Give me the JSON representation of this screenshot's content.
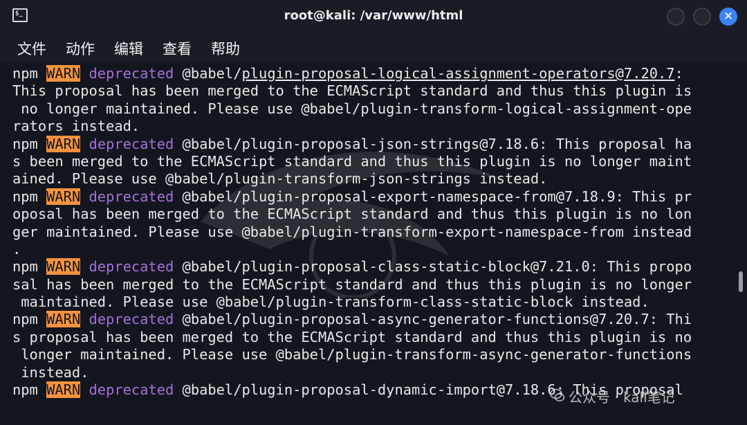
{
  "window": {
    "title": "root@kali: /var/www/html",
    "icon_name": "terminal-icon",
    "close_glyph": "✕"
  },
  "menu": {
    "items": [
      "文件",
      "动作",
      "编辑",
      "查看",
      "帮助"
    ]
  },
  "terminal": {
    "lines": [
      [
        {
          "t": "npm "
        },
        {
          "t": "WARN",
          "c": "warn"
        },
        {
          "t": " "
        },
        {
          "t": "deprecated",
          "c": "dep"
        },
        {
          "t": " @babel/"
        },
        {
          "t": "plugin-proposal-logical-assignment-operators@7.20.7",
          "c": "ul"
        },
        {
          "t": ":"
        }
      ],
      [
        {
          "t": "This proposal has been merged to the ECMAScript standard and thus this plugin is"
        }
      ],
      [
        {
          "t": " no longer maintained. Please use @babel/plugin-transform-logical-assignment-ope"
        }
      ],
      [
        {
          "t": "rators instead."
        }
      ],
      [
        {
          "t": "npm "
        },
        {
          "t": "WARN",
          "c": "warn"
        },
        {
          "t": " "
        },
        {
          "t": "deprecated",
          "c": "dep"
        },
        {
          "t": " @babel/plugin-proposal-json-strings@7.18.6: This proposal ha"
        }
      ],
      [
        {
          "t": "s been merged to the ECMAScript standard and thus this plugin is no longer maint"
        }
      ],
      [
        {
          "t": "ained. Please use @babel/plugin-transform-json-strings instead."
        }
      ],
      [
        {
          "t": "npm "
        },
        {
          "t": "WARN",
          "c": "warn"
        },
        {
          "t": " "
        },
        {
          "t": "deprecated",
          "c": "dep"
        },
        {
          "t": " @babel/plugin-proposal-export-namespace-from@7.18.9: This pr"
        }
      ],
      [
        {
          "t": "oposal has been merged to the ECMAScript standard and thus this plugin is no lon"
        }
      ],
      [
        {
          "t": "ger maintained. Please use @babel/plugin-transform-export-namespace-from instead"
        }
      ],
      [
        {
          "t": "."
        }
      ],
      [
        {
          "t": "npm "
        },
        {
          "t": "WARN",
          "c": "warn"
        },
        {
          "t": " "
        },
        {
          "t": "deprecated",
          "c": "dep"
        },
        {
          "t": " @babel/plugin-proposal-class-static-block@7.21.0: This propo"
        }
      ],
      [
        {
          "t": "sal has been merged to the ECMAScript standard and thus this plugin is no longer"
        }
      ],
      [
        {
          "t": " maintained. Please use @babel/plugin-transform-class-static-block instead."
        }
      ],
      [
        {
          "t": "npm "
        },
        {
          "t": "WARN",
          "c": "warn"
        },
        {
          "t": " "
        },
        {
          "t": "deprecated",
          "c": "dep"
        },
        {
          "t": " @babel/plugin-proposal-async-generator-functions@7.20.7: Thi"
        }
      ],
      [
        {
          "t": "s proposal has been merged to the ECMAScript standard and thus this plugin is no"
        }
      ],
      [
        {
          "t": " longer maintained. Please use @babel/plugin-transform-async-generator-functions"
        }
      ],
      [
        {
          "t": " instead."
        }
      ],
      [
        {
          "t": "npm "
        },
        {
          "t": "WARN",
          "c": "warn"
        },
        {
          "t": " "
        },
        {
          "t": "deprecated",
          "c": "dep"
        },
        {
          "t": " @babel/plugin-proposal-dynamic-import@7.18.6: This proposal"
        }
      ]
    ]
  },
  "watermark": {
    "text": "公众号 · kali笔记"
  },
  "colors": {
    "warn_bg": "#f5923e",
    "deprecated": "#a470d8",
    "close_button": "#3b82f6"
  }
}
